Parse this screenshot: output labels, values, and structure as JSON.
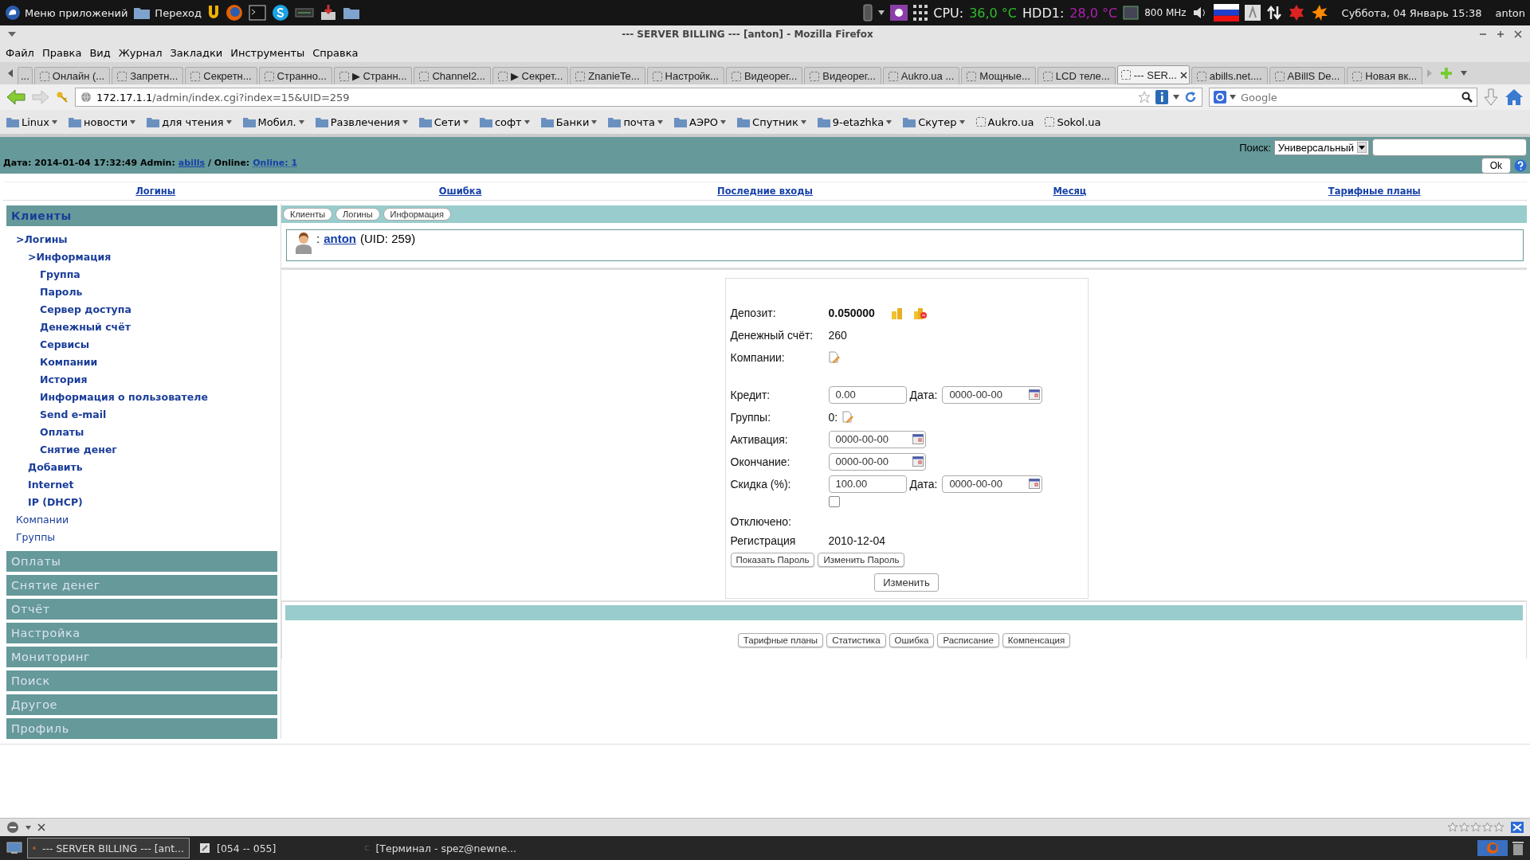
{
  "system_panel": {
    "apps_menu": "Меню приложений",
    "places": "Переход",
    "cpu_label": "CPU:",
    "cpu_temp": "36,0 °C",
    "hdd_label": "HDD1:",
    "hdd_temp": "28,0 °C",
    "cpu_freq": "800 MHz",
    "clock": "Суббота, 04 Январь 15:38",
    "user": "anton"
  },
  "window": {
    "title": "--- SERVER BILLING --- [anton] - Mozilla Firefox"
  },
  "menu": [
    "Файл",
    "Правка",
    "Вид",
    "Журнал",
    "Закладки",
    "Инструменты",
    "Справка"
  ],
  "tabs": [
    {
      "label": "...",
      "selected": false
    },
    {
      "label": "Онлайн (...",
      "selected": false
    },
    {
      "label": "Запретн...",
      "selected": false
    },
    {
      "label": "Секретн...",
      "selected": false
    },
    {
      "label": "Странно...",
      "selected": false
    },
    {
      "label": "▶ Странн...",
      "selected": false
    },
    {
      "label": "Channel2...",
      "selected": false
    },
    {
      "label": "▶ Секрет...",
      "selected": false
    },
    {
      "label": "ZnanieTe...",
      "selected": false
    },
    {
      "label": "Настройк...",
      "selected": false
    },
    {
      "label": "Видеорег...",
      "selected": false
    },
    {
      "label": "Видеорег...",
      "selected": false
    },
    {
      "label": "Aukro.ua ...",
      "selected": false
    },
    {
      "label": "Мощные...",
      "selected": false
    },
    {
      "label": "LCD теле...",
      "selected": false
    },
    {
      "label": "--- SER...",
      "selected": true
    },
    {
      "label": "abills.net....",
      "selected": false
    },
    {
      "label": "ABillS De...",
      "selected": false
    },
    {
      "label": "Новая вк...",
      "selected": false
    }
  ],
  "address_bar": {
    "host": "172.17.1.1",
    "path": "/admin/index.cgi?index=15&UID=259"
  },
  "search_box": {
    "placeholder": "Google"
  },
  "bookmarks": [
    {
      "label": "Linux",
      "kind": "folder"
    },
    {
      "label": "новости",
      "kind": "folder"
    },
    {
      "label": "для чтения",
      "kind": "folder"
    },
    {
      "label": "Мобил.",
      "kind": "folder"
    },
    {
      "label": "Развлечения",
      "kind": "folder"
    },
    {
      "label": "Сети",
      "kind": "folder"
    },
    {
      "label": "софт",
      "kind": "folder"
    },
    {
      "label": "Банки",
      "kind": "folder"
    },
    {
      "label": "почта",
      "kind": "folder"
    },
    {
      "label": "АЭРО",
      "kind": "folder"
    },
    {
      "label": "Спутник",
      "kind": "folder"
    },
    {
      "label": "9-etazhka",
      "kind": "folder"
    },
    {
      "label": "Скутер",
      "kind": "folder"
    },
    {
      "label": "Aukro.ua",
      "kind": "page"
    },
    {
      "label": "Sokol.ua",
      "kind": "page"
    }
  ],
  "page": {
    "header": {
      "info": "Дата: 2014-01-04 17:32:49 Admin:",
      "admin": "abills",
      "online_label": "/ Online:",
      "online": "Online: 1",
      "search_label": "Поиск:",
      "search_type": "Универсальный",
      "ok": "Ok"
    },
    "quick_links": [
      "Логины",
      "Ошибка",
      "Последние входы",
      "Месяц",
      "Тарифные планы"
    ],
    "sidebar": [
      {
        "label": "Клиенты",
        "expanded": true,
        "items": [
          {
            "label": ">Логины",
            "open": true,
            "children": [
              {
                "label": ">Информация",
                "open": true,
                "children": [
                  {
                    "label": "Группа"
                  },
                  {
                    "label": "Пароль"
                  },
                  {
                    "label": "Сервер доступа"
                  },
                  {
                    "label": "Денежный счёт"
                  },
                  {
                    "label": "Сервисы"
                  },
                  {
                    "label": "Компании"
                  },
                  {
                    "label": "История"
                  },
                  {
                    "label": "Информация о пользователе"
                  },
                  {
                    "label": "Send e-mail"
                  },
                  {
                    "label": "Оплаты"
                  },
                  {
                    "label": "Снятие денег"
                  }
                ]
              },
              {
                "label": "Добавить"
              },
              {
                "label": "Internet"
              },
              {
                "label": "IP (DHCP)"
              }
            ]
          },
          {
            "label": "Компании"
          },
          {
            "label": "Группы"
          }
        ]
      },
      {
        "label": "Оплаты",
        "expanded": false
      },
      {
        "label": "Снятие денег",
        "expanded": false
      },
      {
        "label": "Отчёт",
        "expanded": false
      },
      {
        "label": "Настройка",
        "expanded": false
      },
      {
        "label": "Мониторинг",
        "expanded": false
      },
      {
        "label": "Поиск",
        "expanded": false
      },
      {
        "label": "Другое",
        "expanded": false
      },
      {
        "label": "Профиль",
        "expanded": false
      }
    ],
    "breadcrumbs": [
      "Клиенты",
      "Логины",
      "Информация"
    ],
    "user": {
      "prefix": ":",
      "login": "anton",
      "uid": "(UID: 259)"
    },
    "form": {
      "deposit": {
        "label": "Депозит:",
        "value": "0.050000"
      },
      "bill": {
        "label": "Денежный счёт:",
        "value": "260"
      },
      "companies": {
        "label": "Компании:"
      },
      "credit": {
        "label": "Кредит:",
        "value": "0.00",
        "date_label": "Дата:",
        "date": "0000-00-00"
      },
      "groups": {
        "label": "Группы:",
        "value": "0:"
      },
      "activation": {
        "label": "Активация:",
        "date": "0000-00-00"
      },
      "expire": {
        "label": "Окончание:",
        "date": "0000-00-00"
      },
      "discount": {
        "label": "Скидка (%):",
        "value": "100.00",
        "date_label": "Дата:",
        "date": "0000-00-00"
      },
      "disabled": {
        "label": "Отключено:",
        "checked": false
      },
      "registration": {
        "label": "Регистрация",
        "value": "2010-12-04"
      },
      "password_buttons": [
        "Показать Пароль",
        "Изменить Пароль"
      ],
      "submit": "Изменить"
    },
    "bottom_buttons": [
      "Тарифные планы",
      "Статистика",
      "Ошибка",
      "Расписание",
      "Компенсация"
    ]
  },
  "taskbar": [
    {
      "label": "--- SERVER BILLING --- [ant...",
      "selected": true,
      "kind": "browser"
    },
    {
      "label": "[054 -- 055]",
      "selected": false,
      "kind": "editor"
    },
    {
      "label": "[Терминал - spez@newne...",
      "selected": false,
      "kind": "terminal"
    }
  ]
}
